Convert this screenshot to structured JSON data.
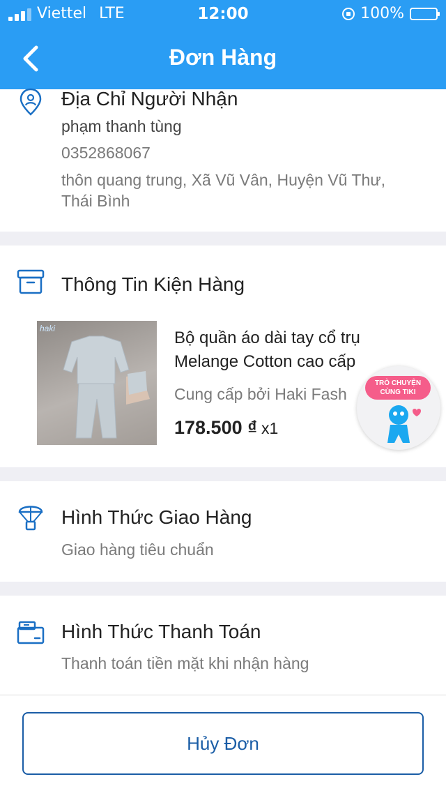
{
  "status_bar": {
    "carrier": "Viettel",
    "network": "LTE",
    "time": "12:00",
    "battery": "100%",
    "battery_level": 1.0,
    "battery_color": "#ffd400"
  },
  "header": {
    "title": "Đơn Hàng",
    "back_icon": "chevron-left-icon",
    "background": "#2a9df4"
  },
  "address": {
    "icon": "location-pin-icon",
    "title": "Địa Chỉ Người Nhận",
    "name": "phạm thanh tùng",
    "phone": "0352868067",
    "address_line1": "thôn quang trung, Xã Vũ Vân, Huyện Vũ Thư,",
    "address_line2": "Thái Bình"
  },
  "package": {
    "icon": "archive-box-icon",
    "title": "Thông Tin Kiện Hàng",
    "product": {
      "image_brand": "haki",
      "name": "Bộ quần áo dài tay cổ trụ Melange Cotton cao cấp",
      "seller": "Cung cấp bởi Haki Fash",
      "price": "178.500 ₫",
      "quantity": "x1"
    }
  },
  "chat": {
    "label_line1": "TRÒ CHUYỆN",
    "label_line2": "CÙNG TIKI"
  },
  "shipping": {
    "icon": "parachute-package-icon",
    "title": "Hình Thức Giao Hàng",
    "value": "Giao hàng tiêu chuẩn"
  },
  "payment": {
    "icon": "wallet-card-icon",
    "title": "Hình Thức Thanh Toán",
    "value": "Thanh toán tiền mặt khi nhận hàng"
  },
  "footer": {
    "cancel_label": "Hủy Đơn",
    "accent": "#1a5da6"
  }
}
